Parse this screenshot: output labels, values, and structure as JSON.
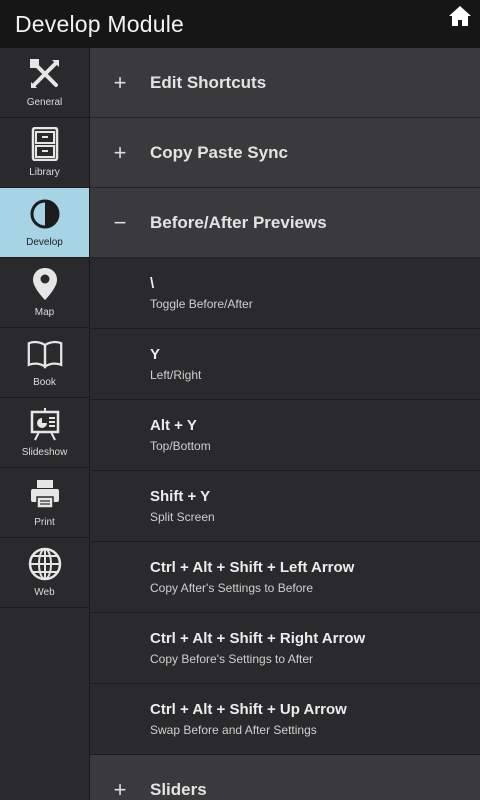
{
  "header": {
    "title": "Develop Module",
    "home_icon": "home-icon"
  },
  "sidebar": {
    "active_color": "#a6d4e4",
    "items": [
      {
        "label": "General",
        "icon": "tools-icon"
      },
      {
        "label": "Library",
        "icon": "cabinet-icon"
      },
      {
        "label": "Develop",
        "icon": "contrast-icon"
      },
      {
        "label": "Map",
        "icon": "map-pin-icon"
      },
      {
        "label": "Book",
        "icon": "book-icon"
      },
      {
        "label": "Slideshow",
        "icon": "presentation-icon"
      },
      {
        "label": "Print",
        "icon": "printer-icon"
      },
      {
        "label": "Web",
        "icon": "globe-icon"
      }
    ]
  },
  "main": {
    "sections": [
      {
        "symbol": "+",
        "title": "Edit Shortcuts"
      },
      {
        "symbol": "+",
        "title": "Copy Paste Sync"
      },
      {
        "symbol": "−",
        "title": "Before/After Previews"
      },
      {
        "symbol": "+",
        "title": "Sliders"
      }
    ],
    "shortcuts": [
      {
        "key": "\\",
        "desc": "Toggle Before/After"
      },
      {
        "key": "Y",
        "desc": "Left/Right"
      },
      {
        "key": "Alt + Y",
        "desc": "Top/Bottom"
      },
      {
        "key": "Shift + Y",
        "desc": "Split Screen"
      },
      {
        "key": "Ctrl + Alt + Shift + Left Arrow",
        "desc": "Copy After's Settings to Before"
      },
      {
        "key": "Ctrl + Alt + Shift + Right Arrow",
        "desc": "Copy Before's Settings to After"
      },
      {
        "key": "Ctrl + Alt + Shift + Up Arrow",
        "desc": "Swap Before and After Settings"
      }
    ]
  }
}
